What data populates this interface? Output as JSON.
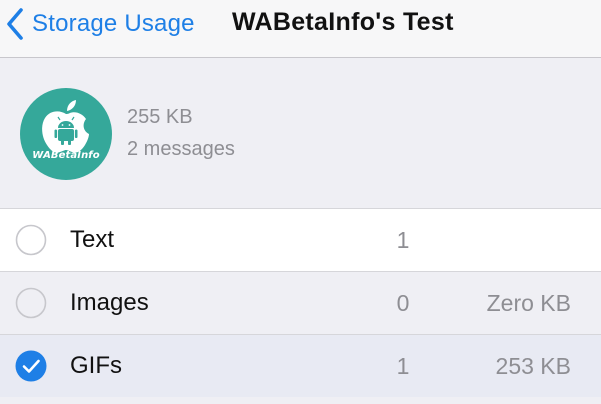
{
  "nav": {
    "back_label": "Storage Usage",
    "title": "WABetaInfo's Test",
    "accent_color": "#1e7fe6"
  },
  "summary": {
    "avatar_text": "WABetaInfo",
    "avatar_color": "#35a89a",
    "size": "255 KB",
    "count": "2 messages"
  },
  "rows": [
    {
      "label": "Text",
      "count": "1",
      "size": "",
      "selected": false,
      "radio_icon": "empty-circle-icon"
    },
    {
      "label": "Images",
      "count": "0",
      "size": "Zero KB",
      "selected": false,
      "radio_icon": "empty-circle-icon"
    },
    {
      "label": "GIFs",
      "count": "1",
      "size": "253 KB",
      "selected": true,
      "radio_icon": "checkmark-circle-icon"
    }
  ]
}
